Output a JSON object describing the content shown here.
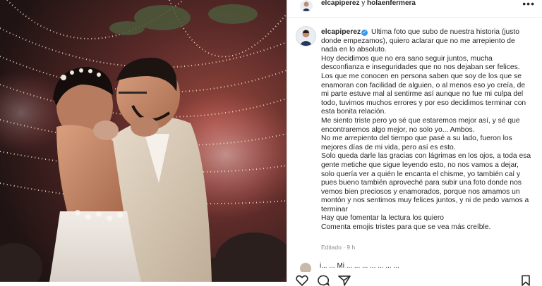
{
  "post": {
    "header_user1": "elcapiperez",
    "header_connector": " y ",
    "header_user2": "holaenfermera",
    "more_icon": "more-horizontal-icon"
  },
  "caption": {
    "username": "elcapiperez",
    "lines": [
      "Ultima foto que subo de nuestra historia (justo donde empezamos), quiero aclarar que no me arrepiento de nada en lo absoluto.",
      "Hoy decidimos que no era sano seguir juntos, mucha desconfianza e inseguridades que no nos dejaban ser felices. Los que me conocen en persona saben que soy de los que se enamoran con facilidad de alguien, o al menos eso yo creía, de mi parte estuve mal al sentirme así aunque no fue mi culpa del todo, tuvimos muchos errores y por eso decidimos terminar con esta bonita relación.",
      "Me siento triste pero yo sé que estaremos mejor así, y sé que encontraremos algo mejor, no solo yo... Ambos.",
      "No me arrepiento del tiempo que pasé a su lado, fueron los mejores días de mi vida, pero así es esto.",
      "Solo queda darle las gracias con lágrimas en los ojos, a toda esa gente metiche que sigue leyendo esto, no nos vamos a dejar, solo quería ver a quién le encanta el chisme, yo también caí y pues bueno también aproveché para subir una foto donde nos vemos bien preciosos y enamorados, porque nos amamos un montón y nos sentimos muy felices juntos, y ni de pedo vamos a terminar",
      "Hay que fomentar la lectura los quiero",
      "Comenta emojis tristes para que se vea más creíble."
    ],
    "meta": "Editado · 9 h"
  },
  "comment": {
    "text": "i... ... Mi ... ... ... ... ... ... ..."
  },
  "icons": {
    "like": "heart-icon",
    "comment": "comment-icon",
    "share": "share-icon",
    "save": "bookmark-icon"
  },
  "colors": {
    "verified": "#3897f0",
    "text": "#262626",
    "muted": "#8e8e8e"
  }
}
